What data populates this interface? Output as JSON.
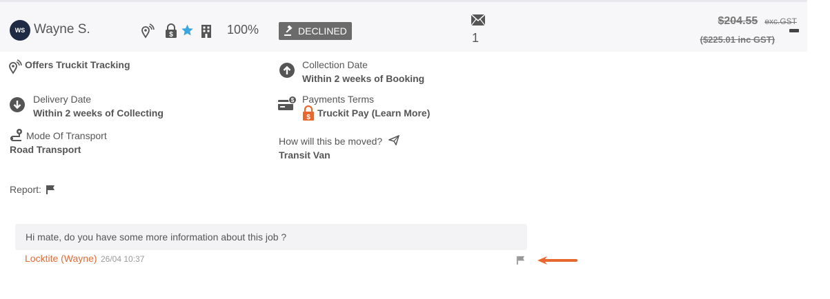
{
  "header": {
    "avatar_initials": "WS",
    "user_name": "Wayne S.",
    "rating": "100%",
    "status": "DECLINED",
    "message_count": "1",
    "price_excl": "$204.55",
    "price_excl_suffix": "exc.GST",
    "price_incl": "($225.01 inc GST)",
    "icons": [
      "tracking-icon",
      "lock-dollar-icon",
      "star-icon",
      "building-icon",
      "gavel-icon",
      "envelope-icon",
      "minus-icon"
    ]
  },
  "details": {
    "tracking": "Offers Truckit Tracking",
    "collection_label": "Collection Date",
    "collection_value": "Within 2 weeks of Booking",
    "delivery_label": "Delivery Date",
    "delivery_value": "Within 2 weeks of Collecting",
    "payment_label": "Payments Terms",
    "payment_value": "Truckit Pay (Learn More)",
    "transport_label": "Mode Of Transport",
    "transport_value": "Road Transport",
    "moved_label": "How will this be moved?",
    "moved_value": "Transit Van",
    "report_label": "Report:"
  },
  "chat": {
    "message": "Hi mate, do you have some more information about this job ?",
    "author": "Locktite (Wayne)",
    "timestamp": "26/04 10:37"
  },
  "colors": {
    "accent": "#e8672f",
    "dark": "#1f2a44",
    "star": "#3aa6e0",
    "badge": "#6b6b6b"
  }
}
